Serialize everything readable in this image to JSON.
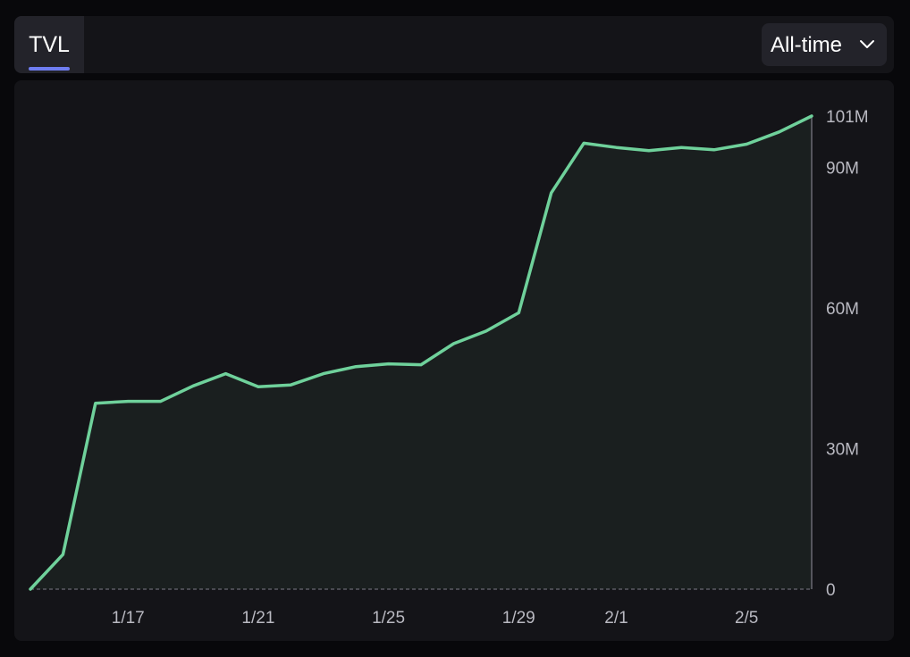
{
  "header": {
    "tab_label": "TVL",
    "range_label": "All-time",
    "range_icon": "chevron-down-icon"
  },
  "colors": {
    "line": "#6fd19b",
    "area": "#1a1f1f",
    "accent": "#6f7df0"
  },
  "chart_data": {
    "type": "area",
    "title": "",
    "xlabel": "",
    "ylabel": "",
    "ylim": [
      0,
      101
    ],
    "yunit": "M",
    "x": [
      "1/14",
      "1/15",
      "1/16",
      "1/17",
      "1/18",
      "1/19",
      "1/20",
      "1/21",
      "1/22",
      "1/23",
      "1/24",
      "1/25",
      "1/26",
      "1/27",
      "1/28",
      "1/29",
      "1/30",
      "1/31",
      "2/1",
      "2/2",
      "2/3",
      "2/4",
      "2/5",
      "2/6",
      "2/7"
    ],
    "values": [
      0,
      7.4,
      39.7,
      40.1,
      40.1,
      43.4,
      46.0,
      43.2,
      43.6,
      46.0,
      47.5,
      48.1,
      47.9,
      52.4,
      55.1,
      59.0,
      84.6,
      95.2,
      94.3,
      93.6,
      94.3,
      93.8,
      95.0,
      97.6,
      101
    ],
    "y_ticks": [
      {
        "value": 0,
        "label": "0"
      },
      {
        "value": 30,
        "label": "30M"
      },
      {
        "value": 60,
        "label": "60M"
      },
      {
        "value": 90,
        "label": "90M"
      },
      {
        "value": 101,
        "label": "101M"
      }
    ],
    "x_ticks": [
      "1/17",
      "1/21",
      "1/25",
      "1/29",
      "2/1",
      "2/5"
    ],
    "grid": false,
    "legend": "none"
  }
}
